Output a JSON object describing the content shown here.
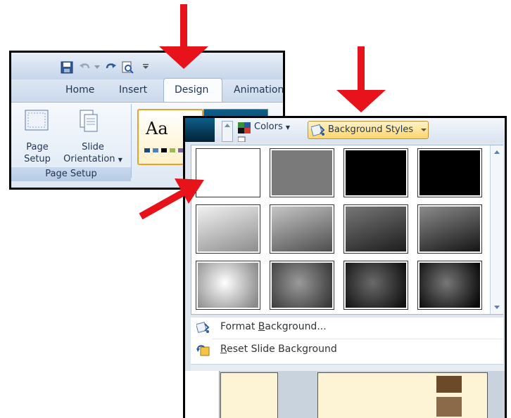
{
  "ribbon": {
    "tabs": [
      "Home",
      "Insert",
      "Design",
      "Animation"
    ],
    "page_setup_label": "Page\nSetup",
    "page_setup_line1": "Page",
    "page_setup_line2": "Setup",
    "slide_orientation_line1": "Slide",
    "slide_orientation_line2": "Orientation",
    "group_label": "Page Setup",
    "theme_sample_text": "Aa"
  },
  "panel": {
    "colors_label": "Colors",
    "background_styles_label": "Background Styles",
    "menu": {
      "format_background": {
        "prefix": "Format ",
        "accel": "B",
        "suffix": "ackground..."
      },
      "reset_background": {
        "accel": "R",
        "suffix": "eset Slide Background"
      }
    }
  },
  "gallery": {
    "rows": 3,
    "cols": 4,
    "styles": [
      {
        "kind": "solid",
        "color": "#ffffff"
      },
      {
        "kind": "solid",
        "color": "#7a7a7a"
      },
      {
        "kind": "solid",
        "color": "#000000"
      },
      {
        "kind": "solid",
        "color": "#000000"
      },
      {
        "kind": "linear",
        "from": "#f4f4f4",
        "to": "#8a8a8a"
      },
      {
        "kind": "linear",
        "from": "#c9c9c9",
        "to": "#4a4a4a"
      },
      {
        "kind": "linear",
        "from": "#7a7a7a",
        "to": "#1a1a1a"
      },
      {
        "kind": "linear",
        "from": "#8f8f8f",
        "to": "#111111"
      },
      {
        "kind": "radial",
        "from": "#ffffff",
        "to": "#8a8a8a"
      },
      {
        "kind": "radial",
        "from": "#9a9a9a",
        "to": "#3a3a3a"
      },
      {
        "kind": "radial",
        "from": "#6a6a6a",
        "to": "#111111"
      },
      {
        "kind": "radial",
        "from": "#777777",
        "to": "#0a0a0a"
      }
    ]
  },
  "colors": {
    "arrow": "#e8121a",
    "selection_border": "#e7a22a",
    "ribbon_text": "#1f3553"
  }
}
